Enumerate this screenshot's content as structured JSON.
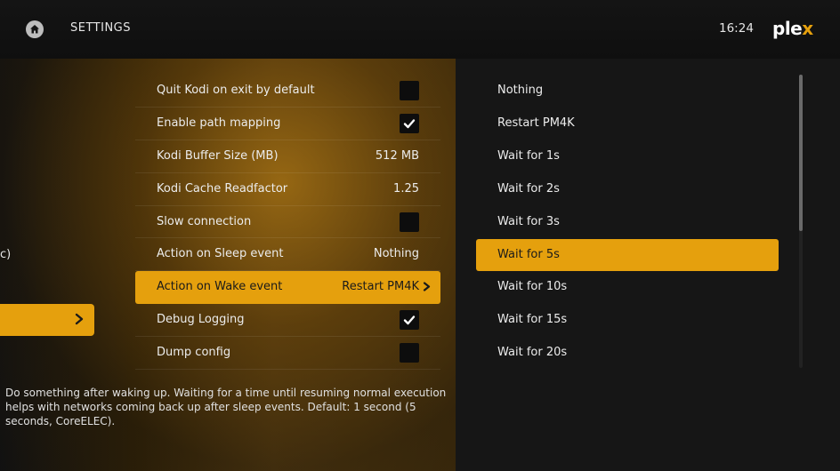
{
  "header": {
    "title": "SETTINGS",
    "clock": "16:24",
    "logo_main": "ple",
    "logo_x": "x"
  },
  "left_menu": {
    "partial_label": "c)"
  },
  "settings": [
    {
      "label": "Quit Kodi on exit by default",
      "type": "checkbox",
      "checked": false
    },
    {
      "label": "Enable path mapping",
      "type": "checkbox",
      "checked": true
    },
    {
      "label": "Kodi Buffer Size (MB)",
      "type": "value",
      "value": "512 MB"
    },
    {
      "label": "Kodi Cache Readfactor",
      "type": "value",
      "value": "1.25"
    },
    {
      "label": "Slow connection",
      "type": "checkbox",
      "checked": false
    },
    {
      "label": "Action on Sleep event",
      "type": "value",
      "value": "Nothing"
    },
    {
      "label": "Action on Wake event",
      "type": "value",
      "value": "Restart PM4K",
      "selected": true
    },
    {
      "label": "Debug Logging",
      "type": "checkbox",
      "checked": true
    },
    {
      "label": "Dump config",
      "type": "checkbox",
      "checked": false
    }
  ],
  "description": "Do something after waking up. Waiting for a time until resuming normal execution helps with networks coming back up after sleep events. Default: 1 second (5 seconds, CoreELEC).",
  "options": [
    {
      "label": "Nothing"
    },
    {
      "label": "Restart PM4K"
    },
    {
      "label": "Wait for 1s"
    },
    {
      "label": "Wait for 2s"
    },
    {
      "label": "Wait for 3s"
    },
    {
      "label": "Wait for 5s",
      "selected": true
    },
    {
      "label": "Wait for 10s"
    },
    {
      "label": "Wait for 15s"
    },
    {
      "label": "Wait for 20s"
    }
  ],
  "colors": {
    "accent": "#e5a00d",
    "checkbox_bg": "#0d0d0d"
  },
  "icons": {
    "home": "home-icon",
    "chevron": "chevron-right-icon",
    "check": "checkmark-icon"
  }
}
